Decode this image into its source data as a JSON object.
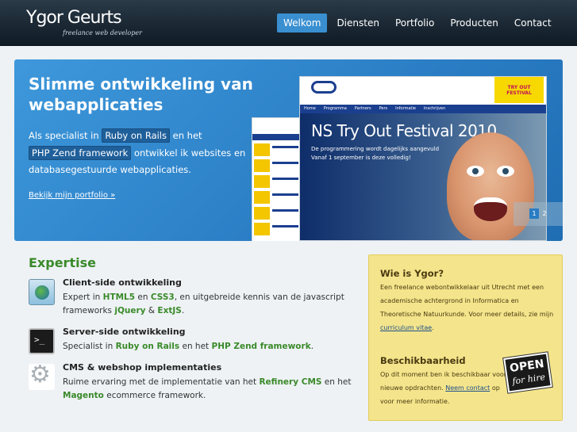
{
  "header": {
    "logo_name": "Ygor Geurts",
    "logo_tagline": "freelance web developer",
    "nav": [
      "Welkom",
      "Diensten",
      "Portfolio",
      "Producten",
      "Contact"
    ],
    "active_index": 0
  },
  "hero": {
    "title": "Slimme ontwikkeling van webapplicaties",
    "lead_1": "Als specialist in ",
    "chip_1": "Ruby on Rails",
    "lead_2": " en het ",
    "chip_2": "PHP Zend framework",
    "lead_3": " ontwikkel ik websites en databasegestuurde webapplicaties.",
    "link": "Bekijk mijn portfolio »",
    "slide_title": "NS Try Out Festival 2010",
    "slide_sub_1": "De programmering wordt dagelijks aangevuld",
    "slide_sub_2": "Vanaf 1 september is deze volledig!",
    "slide_menu": [
      "Home",
      "Programma",
      "Partners",
      "Pers",
      "Informatie",
      "Inschrijven"
    ],
    "festival_label": "TRY OUT FESTIVAL",
    "pager": [
      "1",
      "2"
    ]
  },
  "expertise": {
    "heading": "Expertise",
    "items": [
      {
        "icon": "globe-icon",
        "title": "Client-side ontwikkeling",
        "parts": [
          "Expert in ",
          "HTML5",
          " en ",
          "CSS3",
          ", en uitgebreide kennis van de javascript frameworks ",
          "jQuery",
          " & ",
          "ExtJS",
          "."
        ]
      },
      {
        "icon": "terminal-icon",
        "title": "Server-side ontwikkeling",
        "parts": [
          "Specialist in ",
          "Ruby on Rails",
          " en het ",
          "PHP Zend framework",
          "."
        ]
      },
      {
        "icon": "gear-icon",
        "title": "CMS & webshop implementaties",
        "parts": [
          "Ruime ervaring met de implementatie van het ",
          "Refinery CMS",
          " en het ",
          "Magento",
          " ecommerce framework."
        ]
      }
    ]
  },
  "sidebar": {
    "who_title": "Wie is Ygor?",
    "who_text": "Een freelance webontwikkelaar uit Utrecht met een academische achtergrond in Informatica en Theoretische Natuurkunde. Voor meer details, zie mijn ",
    "who_link": "curriculum vitae",
    "who_end": ".",
    "avail_title": "Beschikbaarheid",
    "avail_text_1": "Op dit moment ben ik beschikbaar voor nieuwe opdrachten. ",
    "avail_link": "Neem contact",
    "avail_text_2": " op voor meer informatie.",
    "badge_main": "OPEN",
    "badge_sub": "for hire"
  }
}
